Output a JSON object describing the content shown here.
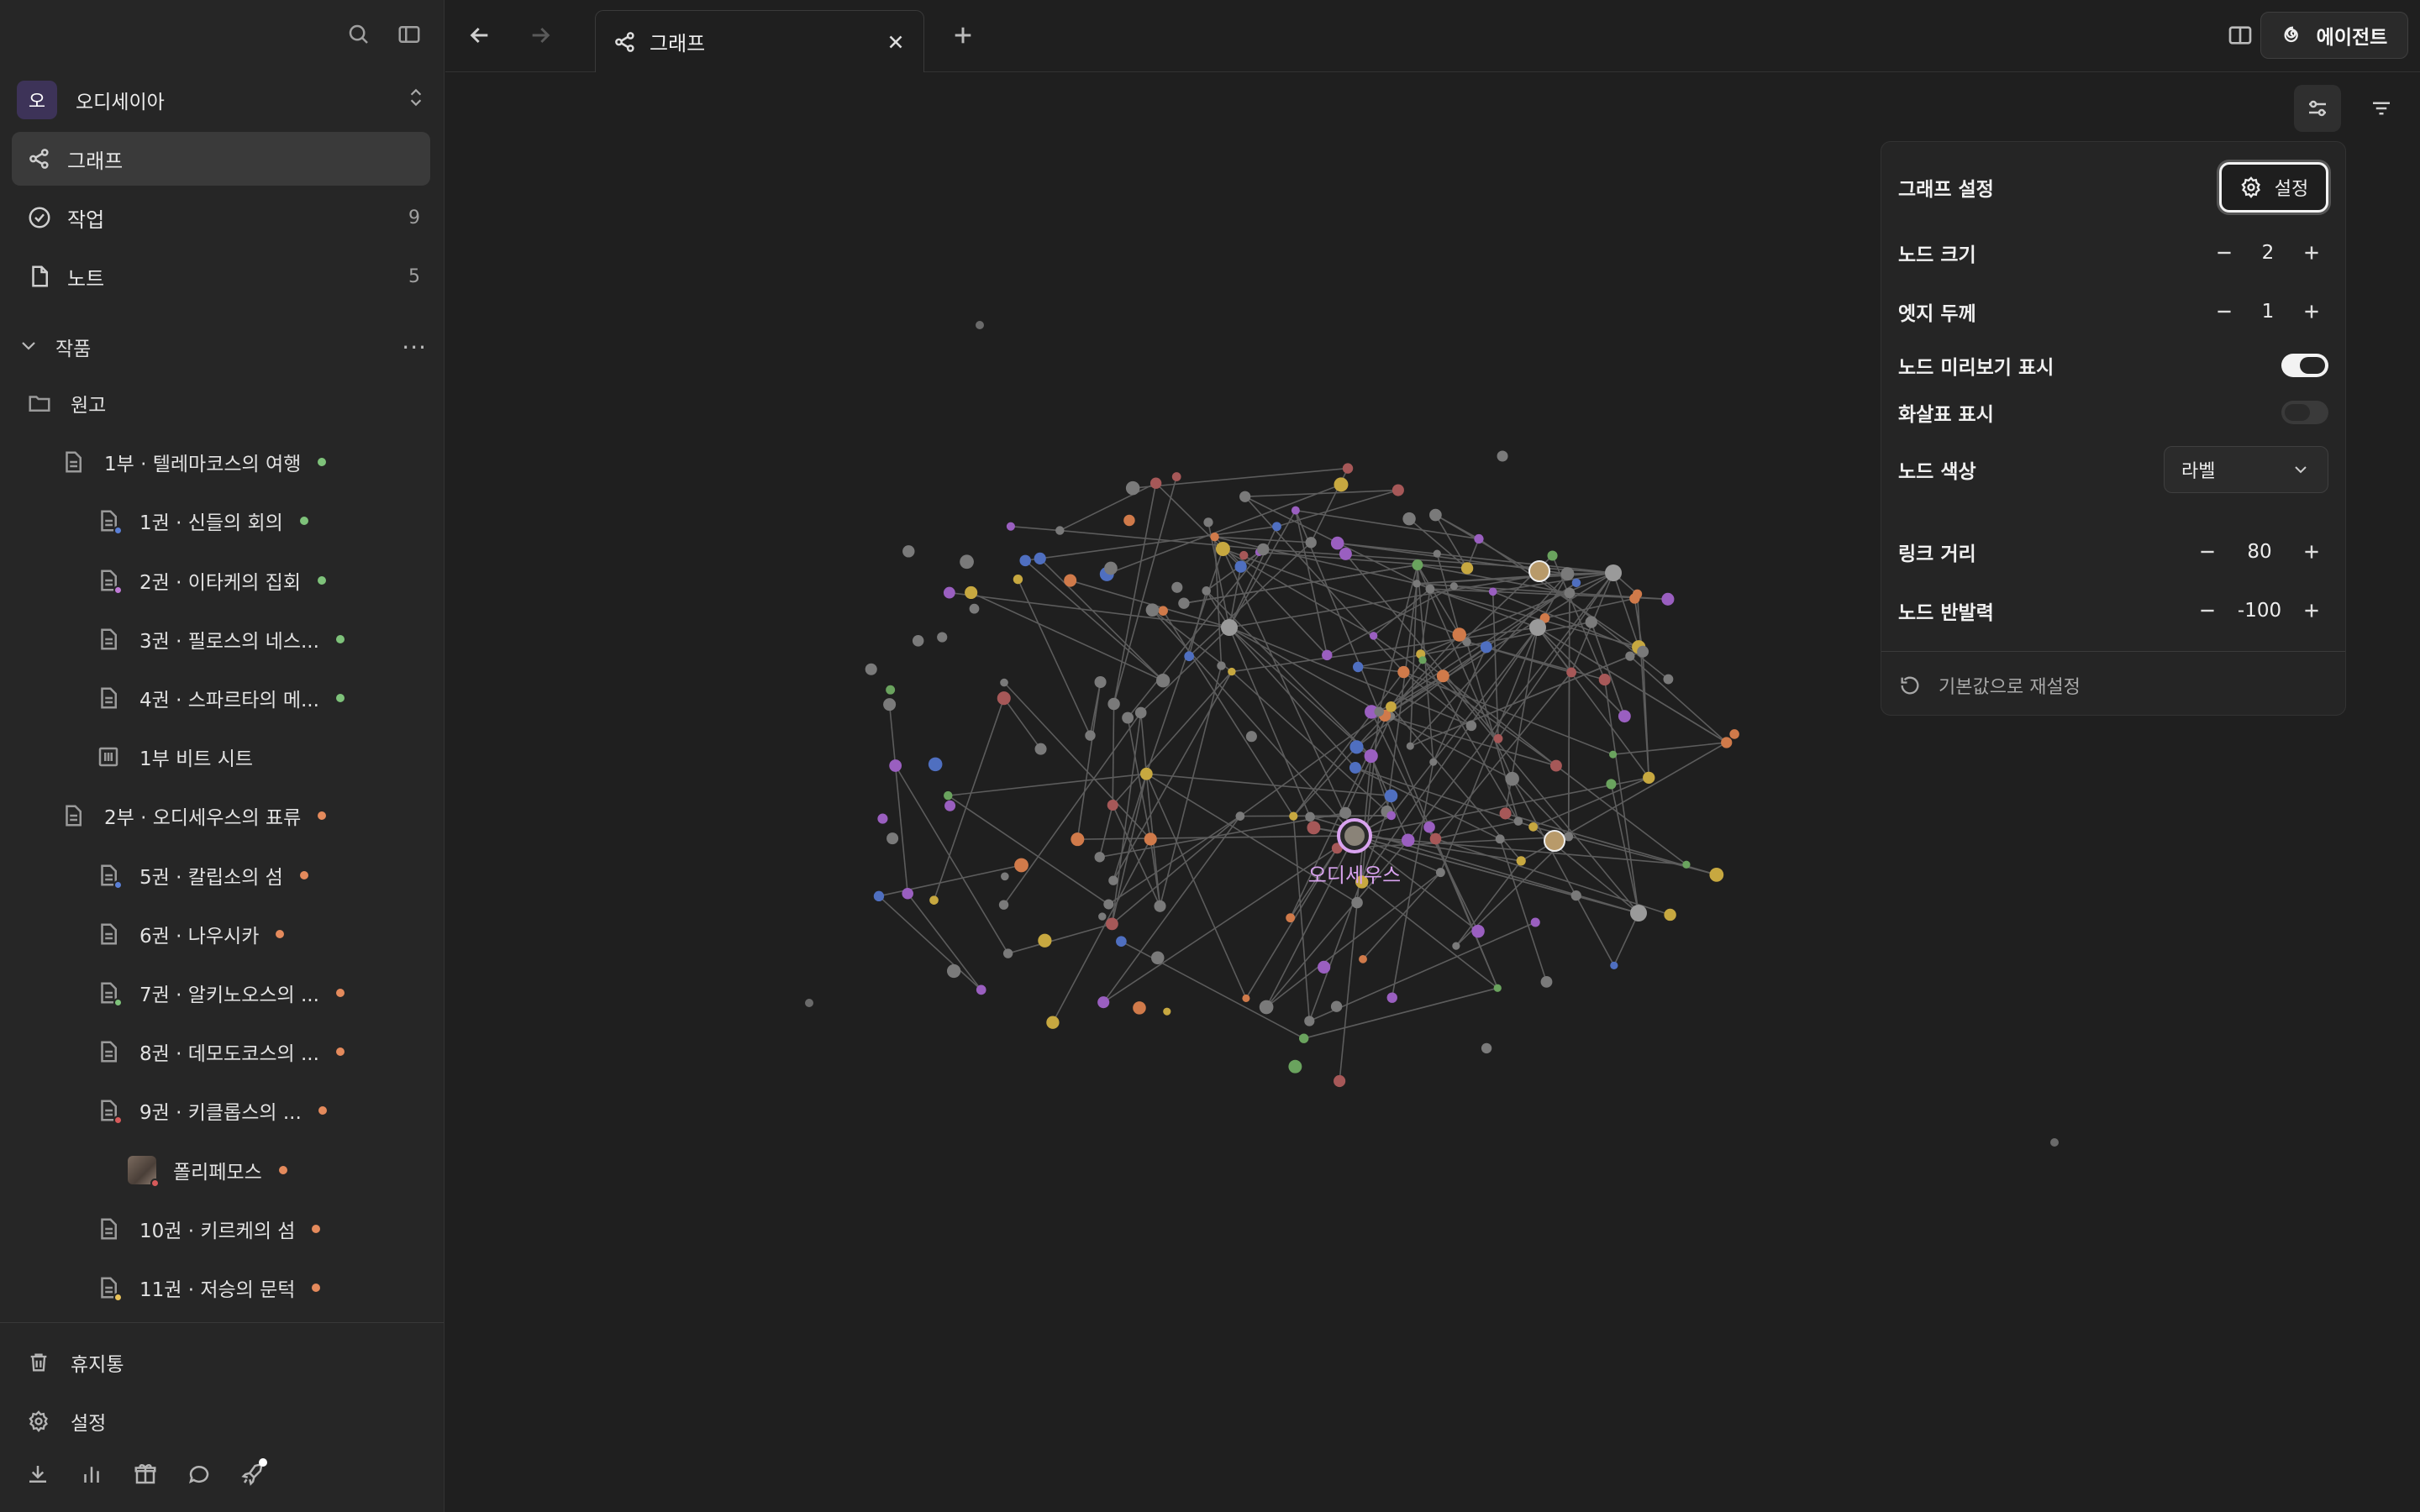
{
  "workspace": {
    "avatar_glyph": "오",
    "name": "오디세이아"
  },
  "nav": [
    {
      "label": "그래프",
      "count": "",
      "icon": "graph-icon",
      "active": true
    },
    {
      "label": "작업",
      "count": "9",
      "icon": "check-circle-icon"
    },
    {
      "label": "노트",
      "count": "5",
      "icon": "note-icon"
    }
  ],
  "section": {
    "label": "작품"
  },
  "tree": [
    {
      "label": "원고",
      "type": "folder"
    },
    {
      "label": "1부 · 텔레마코스의 여행",
      "type": "doc",
      "dot": "#7ec27a"
    },
    {
      "label": "1권 · 신들의 회의",
      "type": "doc",
      "dot": "#7ec27a",
      "sub": "#5a7fd6"
    },
    {
      "label": "2권 · 이타케의 집회",
      "type": "doc",
      "dot": "#7ec27a",
      "sub": "#c07ad6"
    },
    {
      "label": "3권 · 필로스의 네스...",
      "type": "doc",
      "dot": "#7ec27a"
    },
    {
      "label": "4권 · 스파르타의 메...",
      "type": "doc",
      "dot": "#7ec27a"
    },
    {
      "label": "1부 비트 시트",
      "type": "sheet"
    },
    {
      "label": "2부 · 오디세우스의 표류",
      "type": "doc",
      "dot": "#e48a5c"
    },
    {
      "label": "5권 · 칼립소의 섬",
      "type": "doc",
      "dot": "#e48a5c",
      "sub": "#5a7fd6"
    },
    {
      "label": "6권 · 나우시카",
      "type": "doc",
      "dot": "#e48a5c"
    },
    {
      "label": "7권 · 알키노오스의 ...",
      "type": "doc",
      "dot": "#e48a5c",
      "sub": "#7ec27a"
    },
    {
      "label": "8권 · 데모도코스의 ...",
      "type": "doc",
      "dot": "#e48a5c"
    },
    {
      "label": "9권 · 키클롭스의 ...",
      "type": "doc",
      "dot": "#e48a5c",
      "sub": "#d65a5a"
    },
    {
      "label": "폴리페모스",
      "type": "image",
      "dot": "#e48a5c",
      "sub": "#d65a5a"
    },
    {
      "label": "10권 · 키르케의 섬",
      "type": "doc",
      "dot": "#e48a5c"
    },
    {
      "label": "11권 · 저승의 문턱",
      "type": "doc",
      "dot": "#e48a5c",
      "sub": "#e8c25a"
    }
  ],
  "footer": {
    "trash": "휴지통",
    "settings": "설정"
  },
  "tab": {
    "label": "그래프"
  },
  "agent_button": "에이전트",
  "graph": {
    "focus_label": "오디세우스"
  },
  "panel": {
    "title": "그래프 설정",
    "settings_button": "설정",
    "node_size_label": "노드 크기",
    "node_size": "2",
    "edge_width_label": "엣지 두께",
    "edge_width": "1",
    "node_preview_label": "노드 미리보기 표시",
    "node_preview": true,
    "arrows_label": "화살표 표시",
    "arrows": false,
    "node_color_label": "노드 색상",
    "node_color": "라벨",
    "link_distance_label": "링크 거리",
    "link_distance": "80",
    "repulsion_label": "노드 반발력",
    "repulsion": "-100",
    "reset": "기본값으로 재설정"
  }
}
